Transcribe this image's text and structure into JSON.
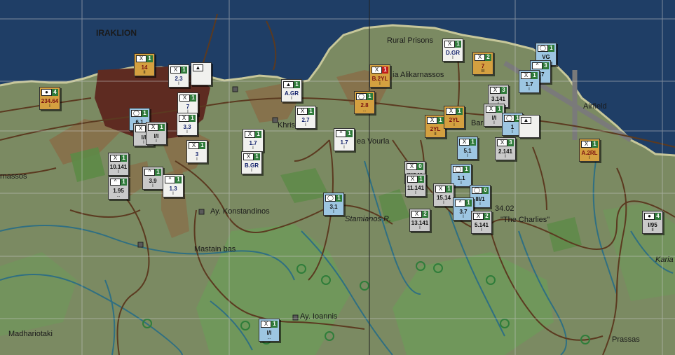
{
  "map": {
    "title_city": "IRAKLION",
    "places": [
      {
        "name": "Rural Prisons"
      },
      {
        "name": "ia Alikarnassos"
      },
      {
        "name": "Khristi"
      },
      {
        "name": "ea Vourla"
      },
      {
        "name": "Barracks"
      },
      {
        "name": "Airfield"
      },
      {
        "name": "rnassos"
      },
      {
        "name": "Ay. Konstandinos"
      },
      {
        "name": "Mastain bas"
      },
      {
        "name": "Stamianos R."
      },
      {
        "name": "34.02"
      },
      {
        "name": "\"The Charlies\""
      },
      {
        "name": "Karia"
      },
      {
        "name": "Ay. Ioannis"
      },
      {
        "name": "Madhariotaki"
      },
      {
        "name": "Prassas"
      }
    ]
  },
  "units": [
    {
      "label": "14",
      "strength": "1",
      "size": "II",
      "side": "aus",
      "icon": "infantry-icon"
    },
    {
      "label": "234.64",
      "strength": "4",
      "size": "I",
      "side": "aus",
      "icon": "artillery-icon"
    },
    {
      "label": "2.3",
      "strength": "1",
      "size": "I",
      "side": "brit",
      "icon": "infantry-icon"
    },
    {
      "label": "",
      "strength": "",
      "size": "",
      "side": "brit",
      "icon": "airborne-icon"
    },
    {
      "label": "7",
      "strength": "1",
      "size": "I",
      "side": "brit",
      "icon": "infantry-icon"
    },
    {
      "label": "3.3",
      "strength": "1",
      "size": "I",
      "side": "brit",
      "icon": "infantry-icon"
    },
    {
      "label": "6.1",
      "strength": "1",
      "size": "I",
      "side": "ger",
      "icon": "armor-icon"
    },
    {
      "label": "I/I",
      "strength": "1",
      "size": "I",
      "side": "grk",
      "icon": "infantry-icon"
    },
    {
      "label": "I/I",
      "strength": "1",
      "size": "I",
      "side": "grk",
      "icon": "infantry-icon"
    },
    {
      "label": "3",
      "strength": "1",
      "size": "I",
      "side": "brit",
      "icon": "infantry-icon"
    },
    {
      "label": "10.141",
      "strength": "1",
      "size": "I",
      "side": "grk",
      "icon": "infantry-icon"
    },
    {
      "label": "1.95",
      "strength": "1",
      "size": "...",
      "side": "grk",
      "icon": "mountain-icon"
    },
    {
      "label": "3.9",
      "strength": "1",
      "size": "I",
      "side": "grk",
      "icon": "mountain-icon"
    },
    {
      "label": "1.3",
      "strength": "1",
      "size": "I",
      "side": "brit",
      "icon": "mountain-icon"
    },
    {
      "label": "1.7",
      "strength": "1",
      "size": "I",
      "side": "brit",
      "icon": "infantry-icon"
    },
    {
      "label": "B.GR",
      "strength": "1",
      "size": "I",
      "side": "brit",
      "icon": "infantry-icon"
    },
    {
      "label": "A.GR",
      "strength": "1",
      "size": "I",
      "side": "brit",
      "icon": "airborne-icon"
    },
    {
      "label": "2.7",
      "strength": "1",
      "size": "I",
      "side": "brit",
      "icon": "infantry-icon"
    },
    {
      "label": "1.7",
      "strength": "1",
      "size": "I",
      "side": "brit",
      "icon": "mountain-icon"
    },
    {
      "label": "D.GR",
      "strength": "1",
      "size": "I",
      "side": "brit",
      "icon": "infantry-icon"
    },
    {
      "label": "B.2YL",
      "strength": "1",
      "size": "I",
      "side": "aus",
      "icon": "infantry-icon",
      "red": true
    },
    {
      "label": "2.8",
      "strength": "1",
      "size": "...",
      "side": "aus",
      "icon": "armor-icon"
    },
    {
      "label": "7",
      "strength": "2",
      "size": "III",
      "side": "aus",
      "icon": "infantry-icon"
    },
    {
      "label": "VG",
      "strength": "1",
      "size": "I",
      "side": "ger",
      "icon": "armor-icon"
    },
    {
      "label": "2.7",
      "strength": "3",
      "size": "I",
      "side": "ger",
      "icon": "mountain-icon"
    },
    {
      "label": "1.7",
      "strength": "1",
      "size": "I",
      "side": "ger",
      "icon": "infantry-icon"
    },
    {
      "label": "3.141",
      "strength": "3",
      "size": "I",
      "side": "grk",
      "icon": "infantry-icon"
    },
    {
      "label": "I/I",
      "strength": "1",
      "size": "I",
      "side": "grk",
      "icon": "infantry-icon"
    },
    {
      "label": "2YL",
      "strength": "1",
      "size": "II",
      "side": "aus",
      "icon": "infantry-icon"
    },
    {
      "label": "2YL",
      "strength": "1",
      "size": "I",
      "side": "aus",
      "icon": "infantry-icon"
    },
    {
      "label": "1",
      "strength": "1",
      "size": "I",
      "side": "ger",
      "icon": "armor-icon"
    },
    {
      "label": "",
      "strength": "",
      "size": "",
      "side": "brit",
      "icon": "airborne-icon"
    },
    {
      "label": "5.1",
      "strength": "1",
      "size": "I",
      "side": "ger",
      "icon": "infantry-icon"
    },
    {
      "label": "2.141",
      "strength": "3",
      "size": "I",
      "side": "grk",
      "icon": "infantry-icon"
    },
    {
      "label": "A.2RL",
      "strength": "1",
      "size": "I",
      "side": "aus",
      "icon": "infantry-icon"
    },
    {
      "label": "III/141",
      "strength": "0",
      "size": "I",
      "side": "grk",
      "icon": "infantry-icon"
    },
    {
      "label": "11.141",
      "strength": "1",
      "size": "I",
      "side": "grk",
      "icon": "infantry-icon"
    },
    {
      "label": "1.1",
      "strength": "1",
      "size": "I",
      "side": "ger",
      "icon": "armor-icon"
    },
    {
      "label": "15.14",
      "strength": "1",
      "size": "I",
      "side": "grk",
      "icon": "infantry-icon"
    },
    {
      "label": "III/1",
      "strength": "0",
      "size": "I",
      "side": "ger",
      "icon": "armor-icon"
    },
    {
      "label": "3.7",
      "strength": "1",
      "size": "I",
      "side": "ger",
      "icon": "mountain-icon"
    },
    {
      "label": "5.141",
      "strength": "2",
      "size": "I",
      "side": "grk",
      "icon": "infantry-icon"
    },
    {
      "label": "13.141",
      "strength": "2",
      "size": "I",
      "side": "grk",
      "icon": "infantry-icon"
    },
    {
      "label": "3.1",
      "strength": "1",
      "size": "I",
      "side": "ger",
      "icon": "armor-icon"
    },
    {
      "label": "I/95",
      "strength": "4",
      "size": "II",
      "side": "grk",
      "icon": "artillery-icon"
    },
    {
      "label": "I/I",
      "strength": "1",
      "size": "...",
      "side": "ger",
      "icon": "infantry-icon"
    }
  ],
  "colors": {
    "sea": "#1f3e66",
    "land": "#7b8a62",
    "city": "#5e2b21",
    "roads": "#5b3a20",
    "rivers": "#2f6f82",
    "hexgrid": "#c9c9c9"
  }
}
